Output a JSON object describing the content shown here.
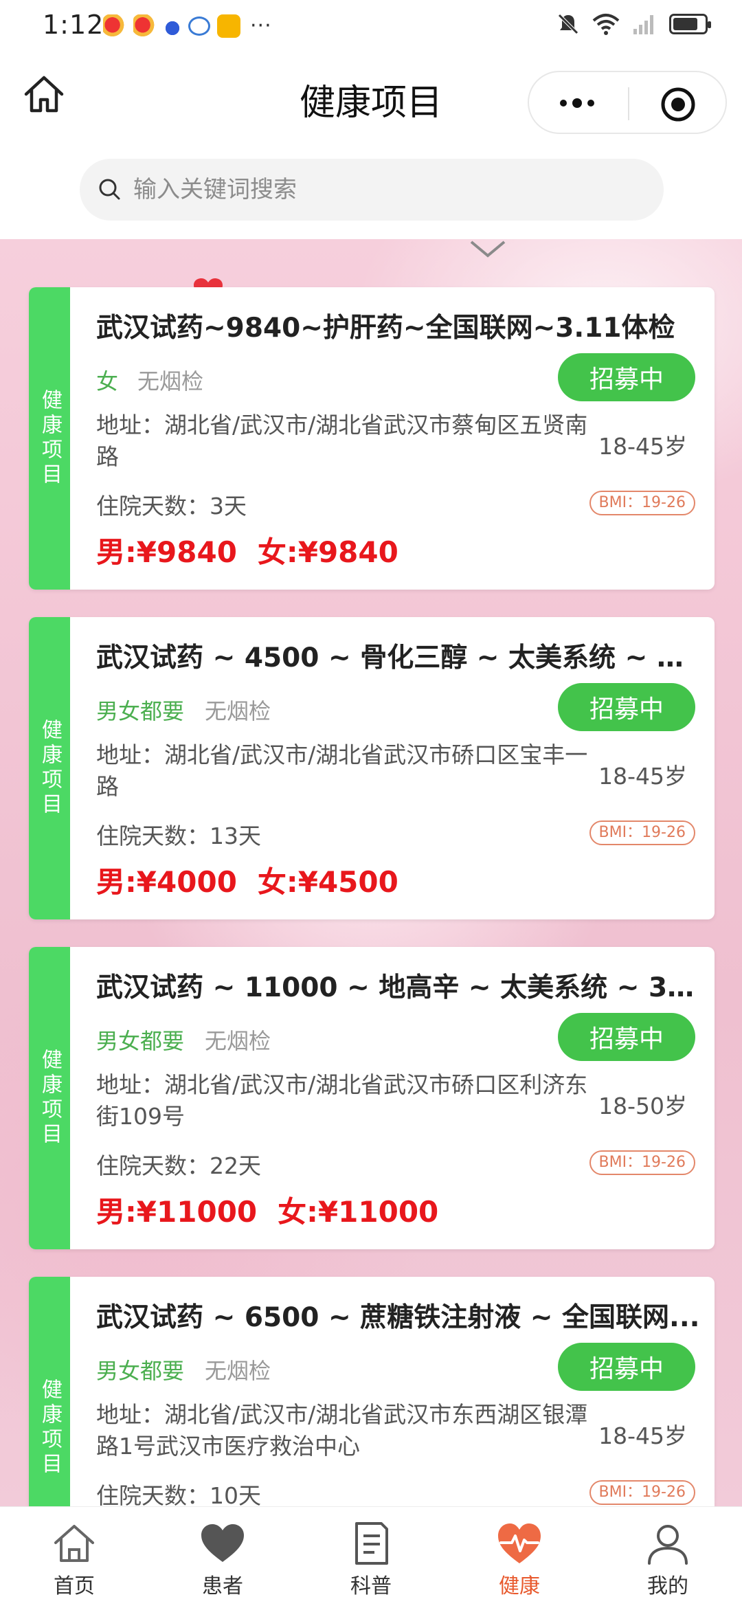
{
  "status_bar": {
    "time": "1:12",
    "more": "···",
    "battery_level": 0.8
  },
  "header": {
    "title": "健康项目"
  },
  "search": {
    "placeholder": "输入关键词搜索"
  },
  "colors": {
    "accent_green": "#43c34b",
    "tag_green": "#4cd964",
    "price_red": "#e8171c",
    "active_tab": "#e8592d"
  },
  "cards": [
    {
      "tag": "健康项目",
      "title": "武汉试药~9840~护肝药~全国联网~3.11体检",
      "gender": "女",
      "smoke": "无烟检",
      "status": "招募中",
      "address": "地址：湖北省/武汉市/湖北省武汉市蔡甸区五贤南路",
      "age": "18-45岁",
      "days": "住院天数：3天",
      "bmi": "BMI：19-26",
      "price_male": "男:¥9840",
      "price_female": "女:¥9840"
    },
    {
      "tag": "健康项目",
      "title": "武汉试药 ~ 4500 ~ 骨化三醇 ~ 太美系统 ~ 3....",
      "gender": "男女都要",
      "smoke": "无烟检",
      "status": "招募中",
      "address": "地址：湖北省/武汉市/湖北省武汉市硚口区宝丰一路",
      "age": "18-45岁",
      "days": "住院天数：13天",
      "bmi": "BMI：19-26",
      "price_male": "男:¥4000",
      "price_female": "女:¥4500"
    },
    {
      "tag": "健康项目",
      "title": "武汉试药 ~ 11000 ~ 地高辛 ~ 太美系统 ~ 3.7...",
      "gender": "男女都要",
      "smoke": "无烟检",
      "status": "招募中",
      "address": "地址：湖北省/武汉市/湖北省武汉市硚口区利济东街109号",
      "age": "18-50岁",
      "days": "住院天数：22天",
      "bmi": "BMI：19-26",
      "price_male": "男:¥11000",
      "price_female": "女:¥11000"
    },
    {
      "tag": "健康项目",
      "title": "武汉试药 ~ 6500 ~ 蔗糖铁注射液 ~ 全国联网...",
      "gender": "男女都要",
      "smoke": "无烟检",
      "status": "招募中",
      "address": "地址：湖北省/武汉市/湖北省武汉市东西湖区银潭路1号武汉市医疗救治中心",
      "age": "18-45岁",
      "days": "住院天数：10天",
      "bmi": "BMI：19-26",
      "price_male": "",
      "price_female": ""
    }
  ],
  "tabbar": [
    {
      "label": "首页",
      "icon": "home-icon"
    },
    {
      "label": "患者",
      "icon": "heart-icon"
    },
    {
      "label": "科普",
      "icon": "document-icon"
    },
    {
      "label": "健康",
      "icon": "health-pulse-icon",
      "active": true
    },
    {
      "label": "我的",
      "icon": "user-icon"
    }
  ]
}
